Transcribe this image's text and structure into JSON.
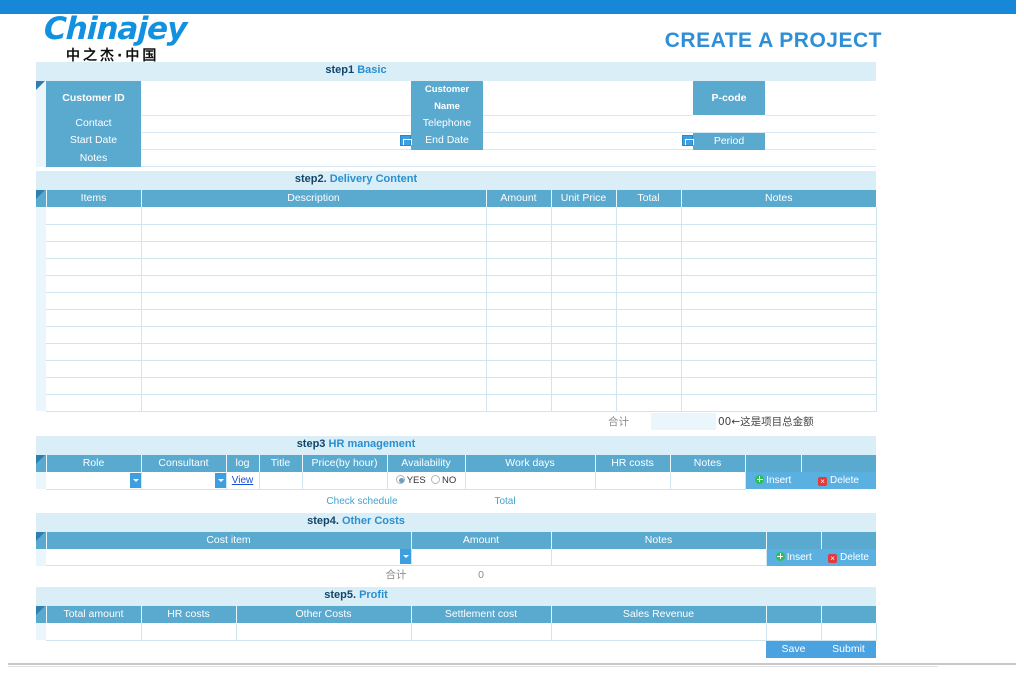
{
  "header": {
    "logo_word": "Chinajey",
    "logo_cn": "中之杰·中国",
    "title": "CREATE A PROJECT",
    "accent": "#2e8fd6",
    "topbar_color": "#1787d8"
  },
  "step1": {
    "num": "step1",
    "label": "Basic",
    "fields": {
      "customer_id": {
        "label": "Customer ID",
        "value": ""
      },
      "customer_name": {
        "label": "Customer Name",
        "value": ""
      },
      "pcode": {
        "label": "P-code",
        "value": ""
      },
      "contact": {
        "label": "Contact",
        "value": ""
      },
      "telephone": {
        "label": "Telephone",
        "value": ""
      },
      "start_date": {
        "label": "Start Date",
        "value": ""
      },
      "end_date": {
        "label": "End Date",
        "value": ""
      },
      "period": {
        "label": "Period",
        "value": ""
      },
      "notes": {
        "label": "Notes",
        "value": ""
      }
    },
    "date_icon": "calendar-icon"
  },
  "step2": {
    "num": "step2.",
    "label": "Delivery Content",
    "columns": [
      "Items",
      "Description",
      "Amount",
      "Unit Price",
      "Total",
      "Notes"
    ],
    "rows": [
      [
        "",
        "",
        "",
        "",
        "",
        ""
      ],
      [
        "",
        "",
        "",
        "",
        "",
        ""
      ],
      [
        "",
        "",
        "",
        "",
        "",
        ""
      ],
      [
        "",
        "",
        "",
        "",
        "",
        ""
      ],
      [
        "",
        "",
        "",
        "",
        "",
        ""
      ],
      [
        "",
        "",
        "",
        "",
        "",
        ""
      ],
      [
        "",
        "",
        "",
        "",
        "",
        ""
      ],
      [
        "",
        "",
        "",
        "",
        "",
        ""
      ],
      [
        "",
        "",
        "",
        "",
        "",
        ""
      ],
      [
        "",
        "",
        "",
        "",
        "",
        ""
      ],
      [
        "",
        "",
        "",
        "",
        "",
        ""
      ],
      [
        "",
        "",
        "",
        "",
        "",
        ""
      ]
    ],
    "total_label": "合计",
    "total_value": "00",
    "total_annotation": "←这是项目总金额"
  },
  "step3": {
    "num": "step3",
    "label": "HR management",
    "columns": [
      "Role",
      "Consultant",
      "log",
      "Title",
      "Price(by hour)",
      "Availability",
      "Work days",
      "HR costs",
      "Notes",
      "",
      ""
    ],
    "row": {
      "role": "",
      "consultant": "",
      "log_link": "View",
      "title": "",
      "price": "",
      "availability_yes": "YES",
      "availability_no": "NO",
      "availability_selected": "YES",
      "work_days": "",
      "hr_costs": "",
      "notes": "",
      "insert_label": "Insert",
      "delete_label": "Delete"
    },
    "check_schedule": "Check schedule",
    "total_label": "Total"
  },
  "step4": {
    "num": "step4.",
    "label": "Other Costs",
    "columns": [
      "Cost item",
      "Amount",
      "Notes",
      "",
      ""
    ],
    "row": {
      "cost_item": "",
      "amount": "",
      "notes": "",
      "insert_label": "Insert",
      "delete_label": "Delete"
    },
    "total_label": "合计",
    "total_value": "0"
  },
  "step5": {
    "num": "step5.",
    "label": "Profit",
    "columns": [
      "Total amount",
      "HR costs",
      "Other Costs",
      "Settlement cost",
      "Sales Revenue",
      "",
      ""
    ],
    "row": [
      "",
      "",
      "",
      "",
      "",
      "",
      ""
    ]
  },
  "actions": {
    "save_label": "Save",
    "submit_label": "Submit"
  }
}
